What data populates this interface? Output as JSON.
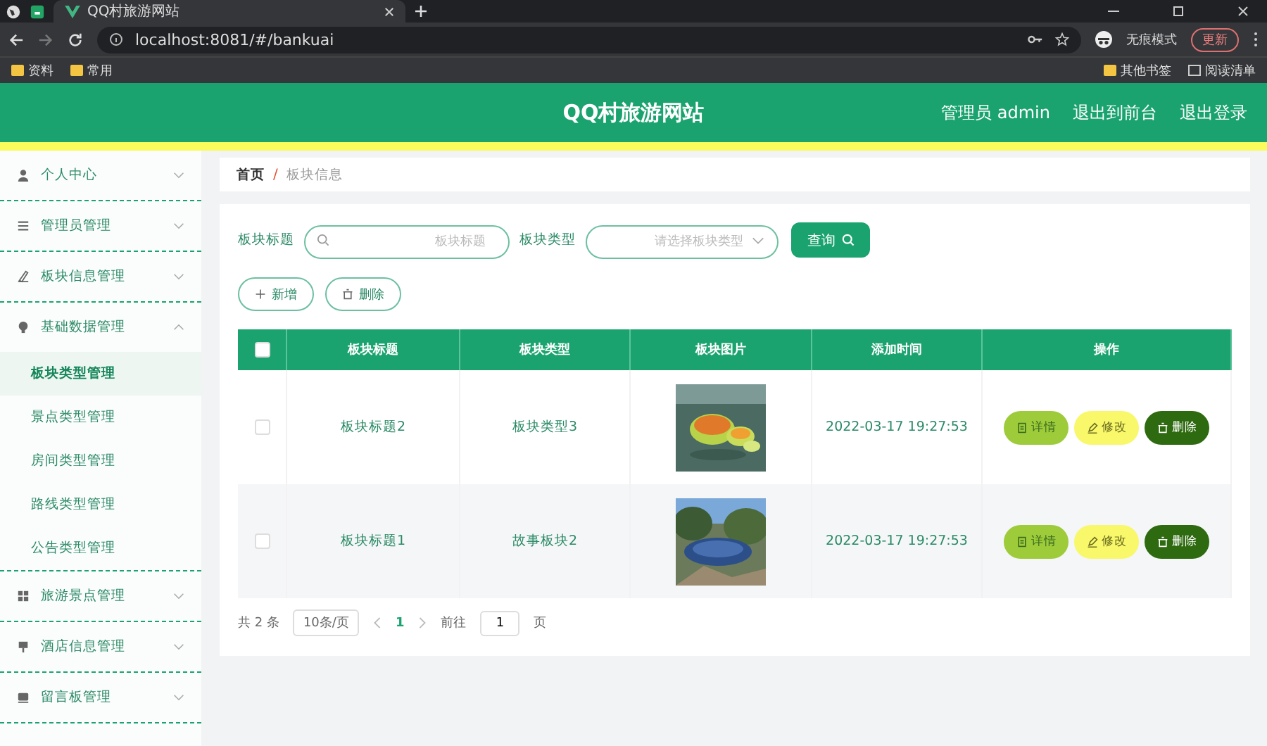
{
  "browser": {
    "tab_title": "QQ村旅游网站",
    "url": "localhost:8081/#/bankuai",
    "incognito_label": "无痕模式",
    "update_button": "更新",
    "bookmarks": [
      "资料",
      "常用"
    ],
    "other_bookmarks": "其他书签",
    "reading_list": "阅读清单"
  },
  "header": {
    "title": "QQ村旅游网站",
    "links": [
      "管理员 admin",
      "退出到前台",
      "退出登录"
    ]
  },
  "sidebar": {
    "items": [
      {
        "label": "个人中心",
        "expanded": false
      },
      {
        "label": "管理员管理",
        "expanded": false
      },
      {
        "label": "板块信息管理",
        "expanded": false
      },
      {
        "label": "基础数据管理",
        "expanded": true,
        "children": [
          {
            "label": "板块类型管理",
            "selected": true
          },
          {
            "label": "景点类型管理",
            "selected": false
          },
          {
            "label": "房间类型管理",
            "selected": false
          },
          {
            "label": "路线类型管理",
            "selected": false
          },
          {
            "label": "公告类型管理",
            "selected": false
          }
        ]
      },
      {
        "label": "旅游景点管理",
        "expanded": false
      },
      {
        "label": "酒店信息管理",
        "expanded": false
      },
      {
        "label": "留言板管理",
        "expanded": false
      }
    ]
  },
  "breadcrumb": [
    "首页",
    "板块信息"
  ],
  "breadcrumb_separator": "/",
  "search": {
    "fields": [
      {
        "label": "板块标题",
        "kind": "text",
        "placeholder": "板块标题"
      },
      {
        "label": "板块类型",
        "kind": "select",
        "placeholder": "请选择板块类型"
      }
    ],
    "query_button": "查询"
  },
  "actions": [
    "新增",
    "删除"
  ],
  "table": {
    "all_checked": false,
    "columns": [
      "板块标题",
      "板块类型",
      "板块图片",
      "添加时间",
      "操作"
    ],
    "rows": [
      {
        "checked": false,
        "title": "板块标题2",
        "type": "板块类型3",
        "time": "2022-03-17 19:27:53",
        "buttons": [
          "详情",
          "修改",
          "删除"
        ]
      },
      {
        "checked": false,
        "title": "板块标题1",
        "type": "故事板块2",
        "time": "2022-03-17 19:27:53",
        "buttons": [
          "详情",
          "修改",
          "删除"
        ]
      }
    ]
  },
  "pagination": {
    "total": "共 2 条",
    "page_size": "10条/页",
    "pages": [
      {
        "label": "1",
        "selected": true
      }
    ],
    "goto_label": "前往",
    "goto_value": "1",
    "goto_suffix": "页"
  }
}
